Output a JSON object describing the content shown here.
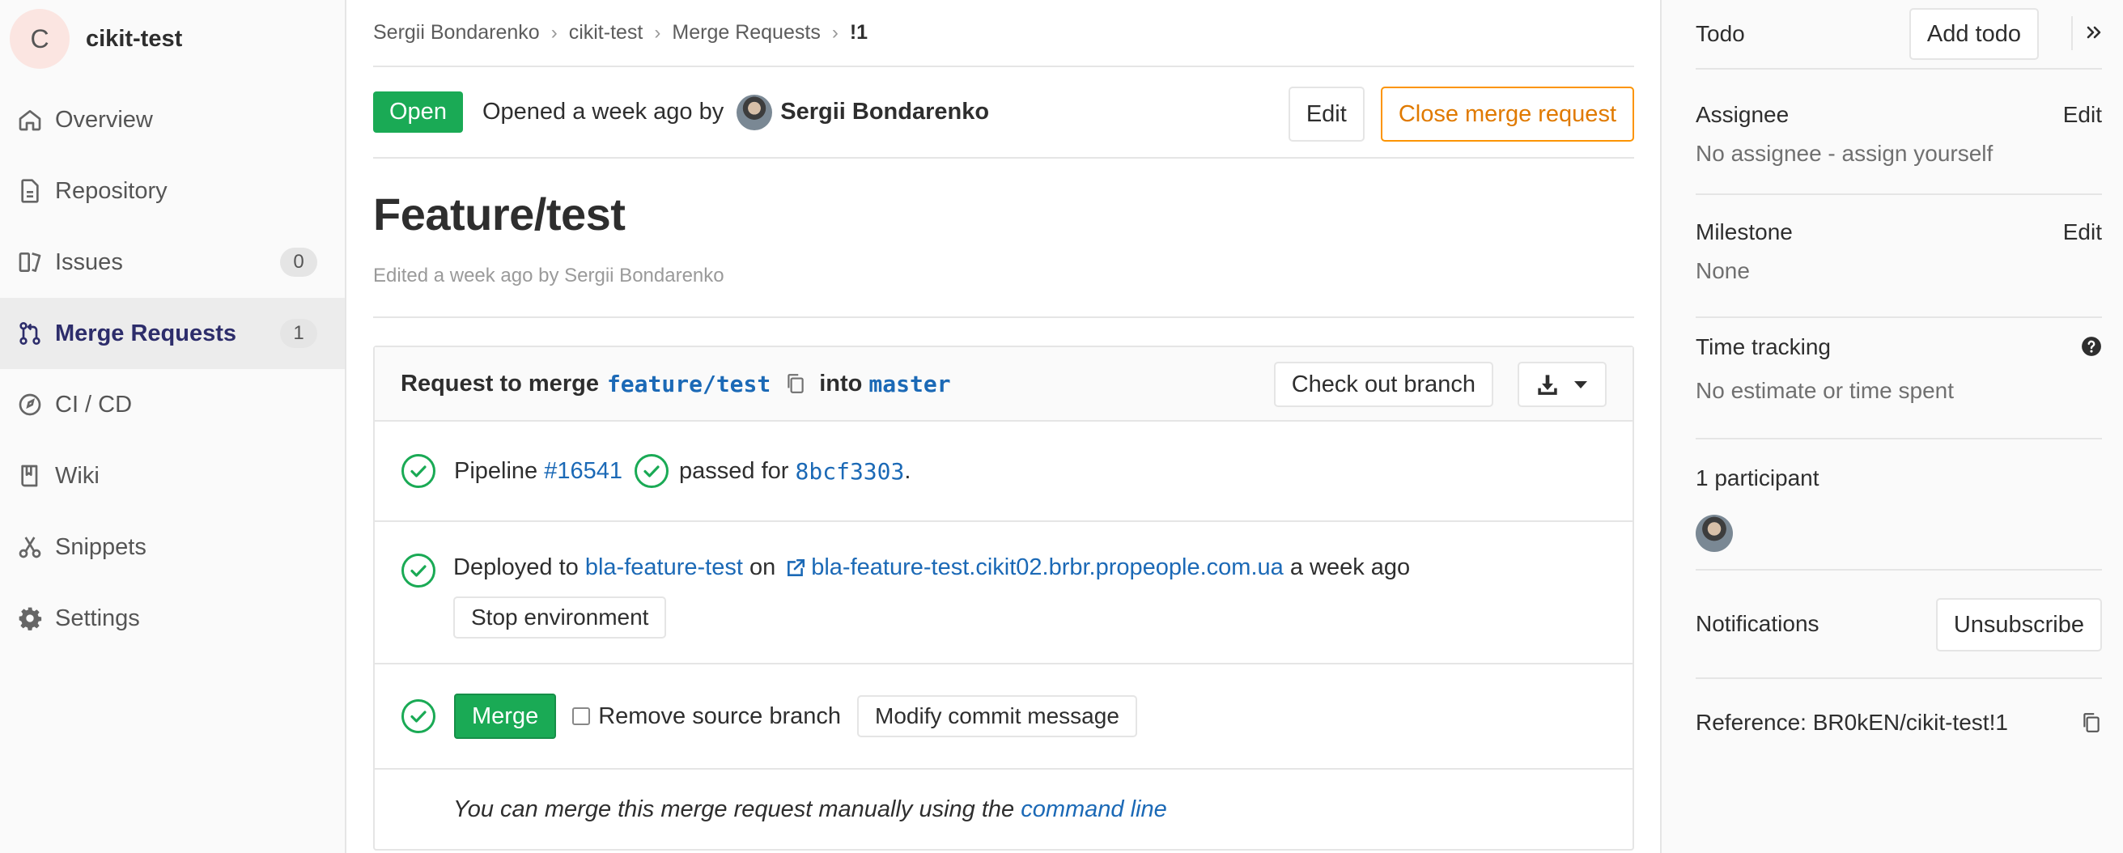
{
  "project": {
    "initial": "C",
    "name": "cikit-test"
  },
  "nav": {
    "items": [
      {
        "label": "Overview",
        "icon": "home-icon"
      },
      {
        "label": "Repository",
        "icon": "document-icon"
      },
      {
        "label": "Issues",
        "icon": "issues-icon",
        "count": "0"
      },
      {
        "label": "Merge Requests",
        "icon": "merge-request-icon",
        "count": "1"
      },
      {
        "label": "CI / CD",
        "icon": "rocket-icon"
      },
      {
        "label": "Wiki",
        "icon": "book-icon"
      },
      {
        "label": "Snippets",
        "icon": "scissors-icon"
      },
      {
        "label": "Settings",
        "icon": "gear-icon"
      }
    ]
  },
  "breadcrumb": [
    "Sergii Bondarenko",
    "cikit-test",
    "Merge Requests",
    "!1"
  ],
  "mr": {
    "status": "Open",
    "opened_text": "Opened a week ago by",
    "author": "Sergii Bondarenko",
    "edit_label": "Edit",
    "close_label": "Close merge request",
    "title": "Feature/test",
    "edited_text": "Edited a week ago by Sergii Bondarenko"
  },
  "widget": {
    "request_prefix": "Request to merge",
    "source_branch": "feature/test",
    "into_text": "into",
    "target_branch": "master",
    "checkout_label": "Check out branch",
    "pipeline": {
      "prefix": "Pipeline",
      "id": "#16541",
      "passed_text": "passed for",
      "sha": "8bcf3303",
      "suffix": "."
    },
    "deploy": {
      "prefix": "Deployed to",
      "environment": "bla-feature-test",
      "on_text": "on",
      "url": "bla-feature-test.cikit02.brbr.propeople.com.ua",
      "time": "a week ago",
      "stop_label": "Stop environment"
    },
    "merge": {
      "merge_label": "Merge",
      "remove_branch_label": "Remove source branch",
      "modify_label": "Modify commit message"
    },
    "manual": {
      "text": "You can merge this merge request manually using the",
      "link": "command line"
    }
  },
  "sidebar_right": {
    "todo_label": "Todo",
    "add_todo_label": "Add todo",
    "assignee_label": "Assignee",
    "assignee_edit": "Edit",
    "assignee_value": "No assignee - assign yourself",
    "milestone_label": "Milestone",
    "milestone_edit": "Edit",
    "milestone_value": "None",
    "time_label": "Time tracking",
    "time_value": "No estimate or time spent",
    "participants_label": "1 participant",
    "notifications_label": "Notifications",
    "unsubscribe_label": "Unsubscribe",
    "reference": "Reference: BR0kEN/cikit-test!1"
  },
  "colors": {
    "success": "#1aaa55",
    "link": "#1b69b6",
    "warning": "#fc9403",
    "nav_active": "#2d2d6b"
  }
}
